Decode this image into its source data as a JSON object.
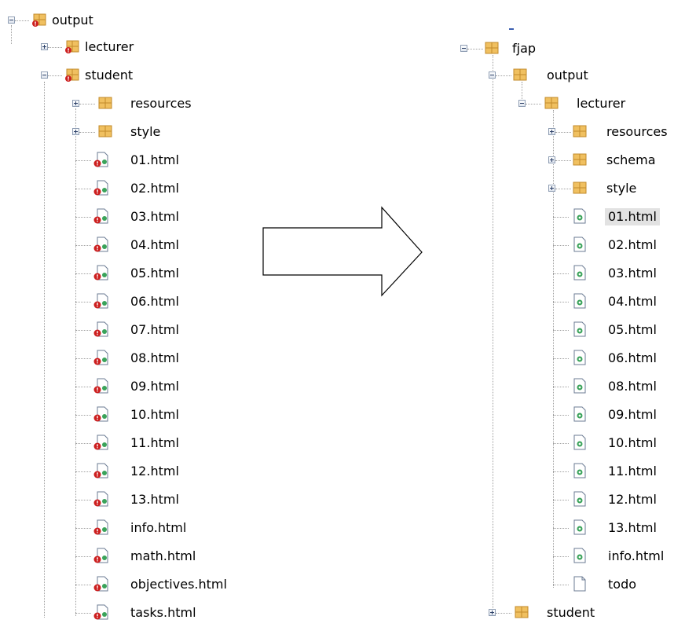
{
  "left_tree": {
    "root": "output",
    "lecturer": "lecturer",
    "student": "student",
    "resources": "resources",
    "style": "style",
    "files": [
      "01.html",
      "02.html",
      "03.html",
      "04.html",
      "05.html",
      "06.html",
      "07.html",
      "08.html",
      "09.html",
      "10.html",
      "11.html",
      "12.html",
      "13.html",
      "info.html",
      "math.html",
      "objectives.html",
      "tasks.html"
    ]
  },
  "right_tree": {
    "root": "fjap",
    "output": "output",
    "lecturer": "lecturer",
    "resources": "resources",
    "schema": "schema",
    "style": "style",
    "files": [
      "01.html",
      "02.html",
      "03.html",
      "04.html",
      "05.html",
      "06.html",
      "08.html",
      "09.html",
      "10.html",
      "11.html",
      "12.html",
      "13.html",
      "info.html"
    ],
    "todo": "todo",
    "student": "student",
    "selected": "01.html"
  },
  "colors": {
    "folder": "#f0c060",
    "folder_edge": "#c28a2a",
    "error_badge": "#cc1f1f",
    "ok_badge": "#3aa35a",
    "expander_border": "#8e9db3",
    "selection": "#e2e2e2"
  },
  "icons": {
    "package": "package-folder-icon",
    "package_error": "package-folder-error-icon",
    "file": "html-file-icon",
    "file_error": "html-file-error-icon",
    "blank": "blank-file-icon",
    "arrow": "right-arrow-icon"
  }
}
